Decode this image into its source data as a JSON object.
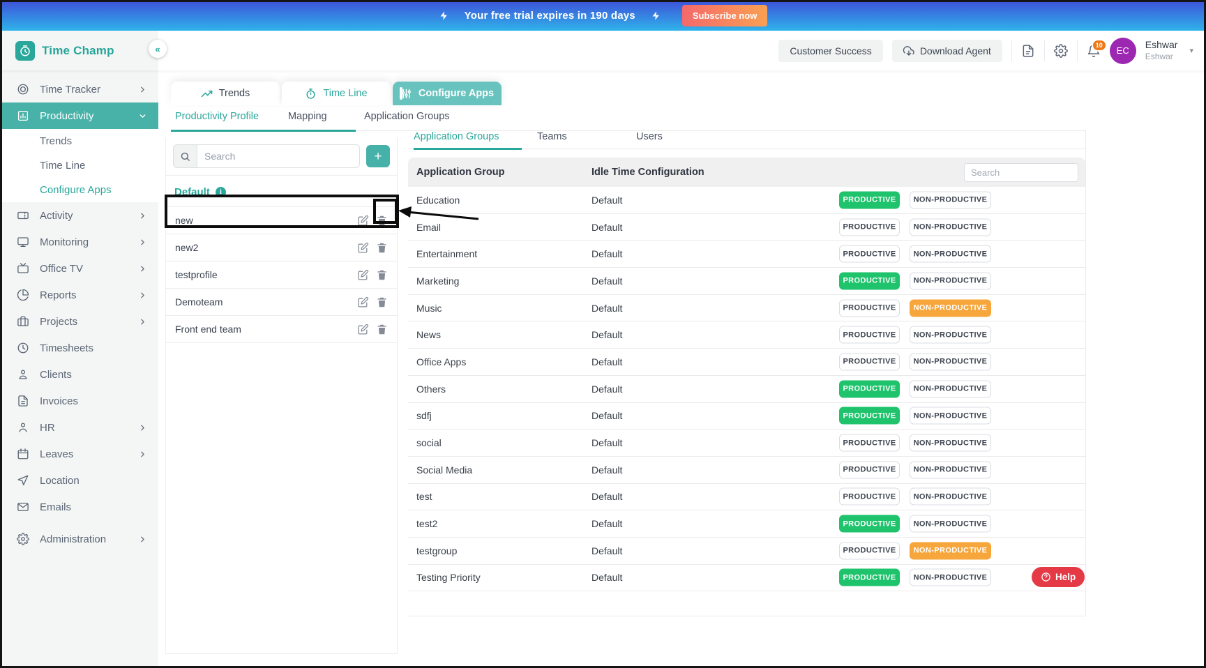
{
  "banner": {
    "message": "Your free trial expires in 190 days",
    "cta_label": "Subscribe now"
  },
  "header": {
    "brand": "Time Champ",
    "customer_success_label": "Customer Success",
    "download_agent_label": "Download Agent",
    "notification_count": "10",
    "avatar_initials": "EC",
    "user_name": "Eshwar",
    "user_subtitle": "Eshwar"
  },
  "sidebar": {
    "items": [
      {
        "label": "Time Tracker",
        "icon": "target",
        "expandable": true
      },
      {
        "label": "Productivity",
        "icon": "chart",
        "expandable": true,
        "active": true,
        "children": [
          {
            "label": "Trends"
          },
          {
            "label": "Time Line"
          },
          {
            "label": "Configure Apps",
            "active": true
          }
        ]
      },
      {
        "label": "Activity",
        "icon": "ticket",
        "expandable": true
      },
      {
        "label": "Monitoring",
        "icon": "monitor",
        "expandable": true
      },
      {
        "label": "Office TV",
        "icon": "tv",
        "expandable": true
      },
      {
        "label": "Reports",
        "icon": "pie",
        "expandable": true
      },
      {
        "label": "Projects",
        "icon": "briefcase",
        "expandable": true
      },
      {
        "label": "Timesheets",
        "icon": "clock"
      },
      {
        "label": "Clients",
        "icon": "client"
      },
      {
        "label": "Invoices",
        "icon": "invoice"
      },
      {
        "label": "HR",
        "icon": "person",
        "expandable": true
      },
      {
        "label": "Leaves",
        "icon": "calendar",
        "expandable": true
      },
      {
        "label": "Location",
        "icon": "send"
      },
      {
        "label": "Emails",
        "icon": "mail"
      },
      {
        "label": "Administration",
        "icon": "gear",
        "expandable": true,
        "gap": true
      }
    ]
  },
  "tabs": {
    "main": [
      {
        "label": "Trends",
        "icon": "trending"
      },
      {
        "label": "Time Line",
        "icon": "stopwatch"
      },
      {
        "label": "Configure Apps",
        "icon": "sliders",
        "active": true
      }
    ],
    "sub": [
      {
        "label": "Productivity Profile",
        "active": true
      },
      {
        "label": "Mapping"
      },
      {
        "label": "Application Groups"
      }
    ]
  },
  "profiles": {
    "search_placeholder": "Search",
    "add_button_label": "+",
    "group_label": "Default",
    "items": [
      "new",
      "new2",
      "testprofile",
      "Demoteam",
      "Front end team"
    ]
  },
  "groups": {
    "tabs": [
      {
        "label": "Application Groups",
        "active": true
      },
      {
        "label": "Teams"
      },
      {
        "label": "Users"
      }
    ],
    "columns": [
      "Application Group",
      "Idle Time Configuration"
    ],
    "search_placeholder": "Search",
    "productive_label": "PRODUCTIVE",
    "non_productive_label": "NON-PRODUCTIVE",
    "rows": [
      {
        "name": "Education",
        "idle": "Default",
        "state": "productive"
      },
      {
        "name": "Email",
        "idle": "Default",
        "state": "none"
      },
      {
        "name": "Entertainment",
        "idle": "Default",
        "state": "none"
      },
      {
        "name": "Marketing",
        "idle": "Default",
        "state": "productive"
      },
      {
        "name": "Music",
        "idle": "Default",
        "state": "non_productive"
      },
      {
        "name": "News",
        "idle": "Default",
        "state": "none"
      },
      {
        "name": "Office Apps",
        "idle": "Default",
        "state": "none"
      },
      {
        "name": "Others",
        "idle": "Default",
        "state": "productive"
      },
      {
        "name": "sdfj",
        "idle": "Default",
        "state": "productive"
      },
      {
        "name": "social",
        "idle": "Default",
        "state": "none"
      },
      {
        "name": "Social Media",
        "idle": "Default",
        "state": "none"
      },
      {
        "name": "test",
        "idle": "Default",
        "state": "none"
      },
      {
        "name": "test2",
        "idle": "Default",
        "state": "productive"
      },
      {
        "name": "testgroup",
        "idle": "Default",
        "state": "non_productive"
      },
      {
        "name": "Testing Priority",
        "idle": "Default",
        "state": "productive"
      }
    ]
  },
  "help": {
    "label": "Help"
  },
  "colors": {
    "teal": "#2aa79b",
    "tab_active_teal": "#68c3be",
    "sidebar_active_teal": "#48b1a8",
    "productive_green": "#1ec36c",
    "non_productive_orange": "#f6a63b",
    "help_red": "#e53946",
    "badge_orange": "#ef7918",
    "avatar_purple": "#9c27b0"
  }
}
